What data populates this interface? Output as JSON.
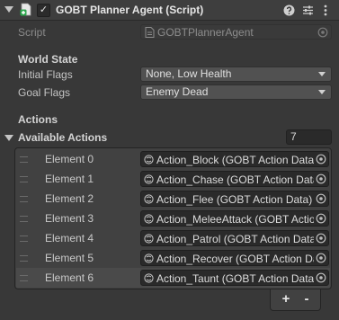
{
  "component": {
    "title": "GOBT Planner Agent (Script)",
    "toggle_mark": "✓"
  },
  "script": {
    "label": "Script",
    "value": "GOBTPlannerAgent"
  },
  "world_state": {
    "heading": "World State",
    "initial_flags_label": "Initial Flags",
    "initial_flags_value": "None, Low Health",
    "goal_flags_label": "Goal Flags",
    "goal_flags_value": "Enemy Dead"
  },
  "actions": {
    "heading": "Actions",
    "available_label": "Available Actions",
    "count": "7",
    "elements": [
      {
        "label": "Element 0",
        "value": "Action_Block (GOBT Action Data)"
      },
      {
        "label": "Element 1",
        "value": "Action_Chase (GOBT Action Data)"
      },
      {
        "label": "Element 2",
        "value": "Action_Flee (GOBT Action Data)"
      },
      {
        "label": "Element 3",
        "value": "Action_MeleeAttack (GOBT Action Data)"
      },
      {
        "label": "Element 4",
        "value": "Action_Patrol (GOBT Action Data)"
      },
      {
        "label": "Element 5",
        "value": "Action_Recover (GOBT Action Data)"
      },
      {
        "label": "Element 6",
        "value": "Action_Taunt (GOBT Action Data)"
      }
    ],
    "add_label": "+",
    "remove_label": "-"
  },
  "icons": {
    "fold": "fold-arrow-icon",
    "script": "script-icon",
    "help": "help-icon",
    "presets": "presets-icon",
    "menu": "kebab-menu-icon",
    "object_picker": "object-picker-icon",
    "scriptable_object": "scriptable-object-icon"
  }
}
